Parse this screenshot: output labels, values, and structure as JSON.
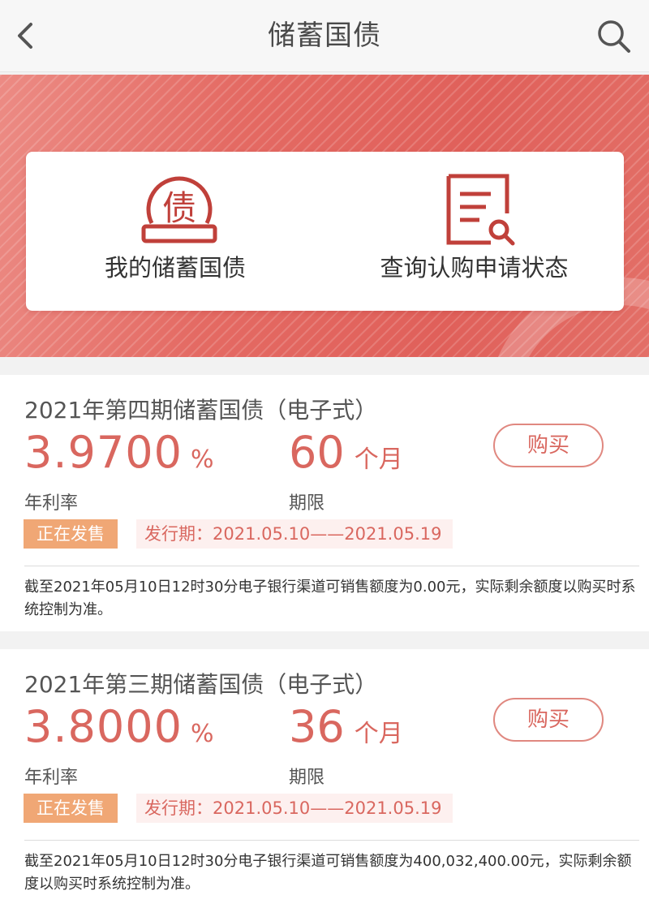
{
  "header": {
    "title": "储蓄国债",
    "back_icon": "chevron-left-icon",
    "search_icon": "search-icon"
  },
  "quick_actions": [
    {
      "label": "我的储蓄国债",
      "icon": "bond-coin-icon",
      "icon_char": "债"
    },
    {
      "label": "查询认购申请状态",
      "icon": "document-search-icon"
    }
  ],
  "bonds": [
    {
      "title": "2021年第四期储蓄国债（电子式）",
      "rate": "3.9700",
      "rate_unit": "%",
      "rate_label": "年利率",
      "term": "60",
      "term_unit": "个月",
      "term_label": "期限",
      "buy_label": "购买",
      "status": "正在发售",
      "period": "发行期：2021.05.10——2021.05.19",
      "notice": "截至2021年05月10日12时30分电子银行渠道可销售额度为0.00元，实际剩余额度以购买时系统控制为准。"
    },
    {
      "title": "2021年第三期储蓄国债（电子式）",
      "rate": "3.8000",
      "rate_unit": "%",
      "rate_label": "年利率",
      "term": "36",
      "term_unit": "个月",
      "term_label": "期限",
      "buy_label": "购买",
      "status": "正在发售",
      "period": "发行期：2021.05.10——2021.05.19",
      "notice": "截至2021年05月10日12时30分电子银行渠道可销售额度为400,032,400.00元，实际剩余额度以购买时系统控制为准。"
    }
  ],
  "colors": {
    "accent": "#d9675f",
    "banner": "#e46a63",
    "badge": "#f0a775",
    "period_bg": "#fdf0ef"
  }
}
